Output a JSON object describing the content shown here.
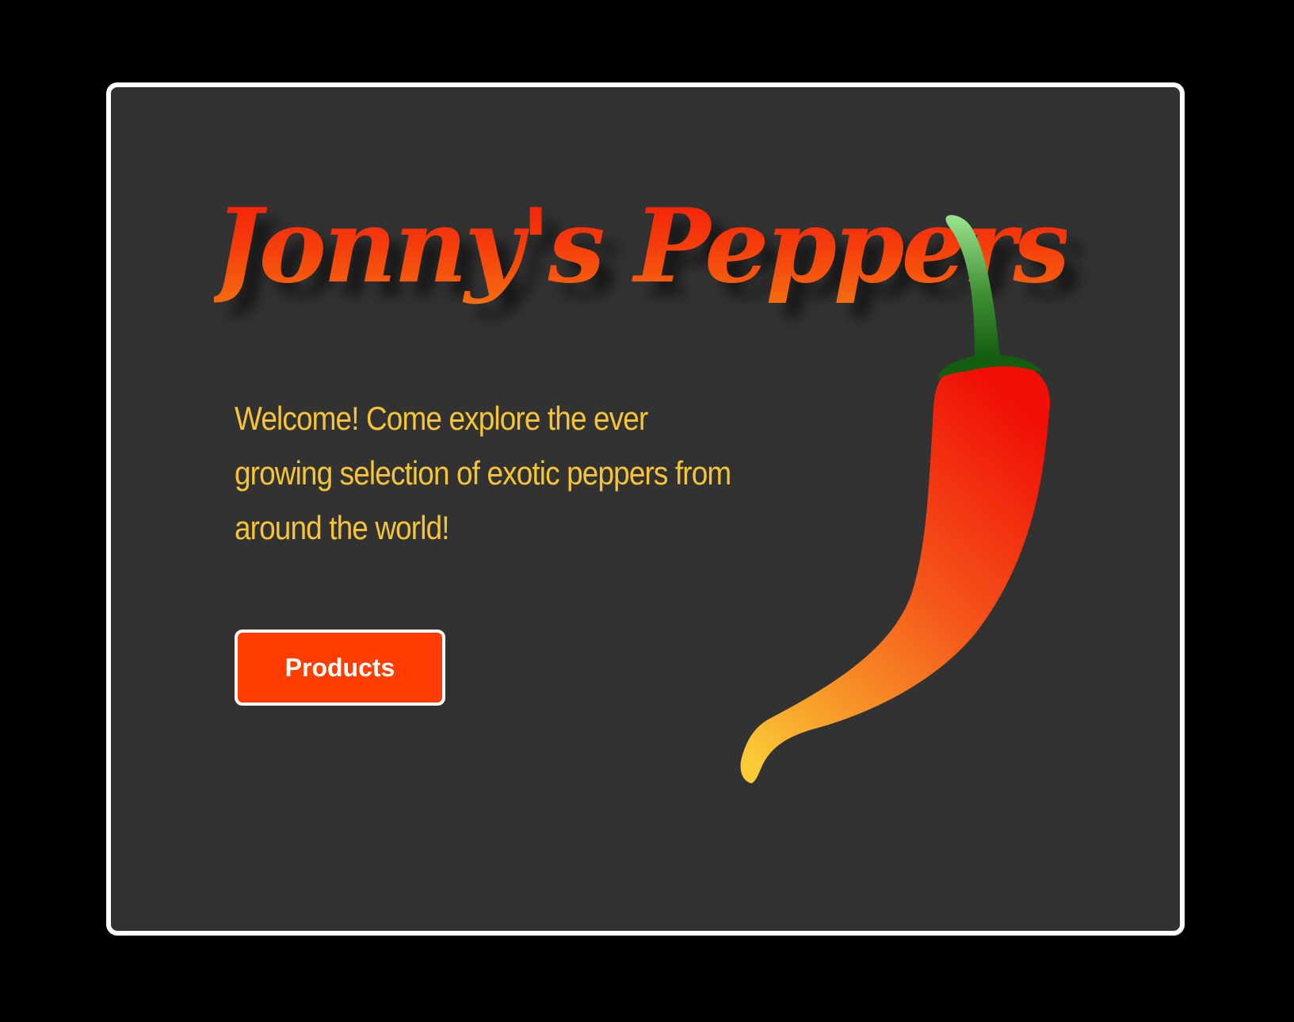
{
  "hero": {
    "title": "Jonny's Peppers",
    "intro": "Welcome! Come explore the ever growing selection of exotic peppers from around the world!",
    "button_label": "Products"
  },
  "colors": {
    "page_background": "#000000",
    "card_background": "#323232",
    "card_border": "#ffffff",
    "title_gradient_top": "#f11a06",
    "title_gradient_bottom": "#f5700f",
    "intro_text": "#f6c437",
    "button_background": "#ff3d00",
    "button_text": "#ffffff",
    "pepper_top": "#f00e06",
    "pepper_bottom": "#fbcb37",
    "stem_light": "#9be590",
    "stem_dark": "#145c10"
  },
  "icons": {
    "illustration": "chili-pepper-icon"
  }
}
